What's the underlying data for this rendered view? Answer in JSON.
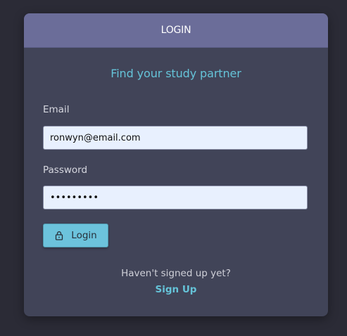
{
  "header": {
    "title": "LOGIN"
  },
  "tagline": "Find your study partner",
  "form": {
    "email_label": "Email",
    "email_value": "ronwyn@email.com",
    "password_label": "Password",
    "password_value": "•••••••••",
    "login_button_label": "Login",
    "login_button_icon": "lock-icon"
  },
  "signup": {
    "prompt": "Haven't signed up yet?",
    "link": "Sign Up"
  },
  "colors": {
    "background": "#2b2b36",
    "card": "#414458",
    "header": "#6b6d99",
    "accent": "#65c3d8",
    "button": "#6cc3dc",
    "input_background": "#e8f0fe"
  }
}
